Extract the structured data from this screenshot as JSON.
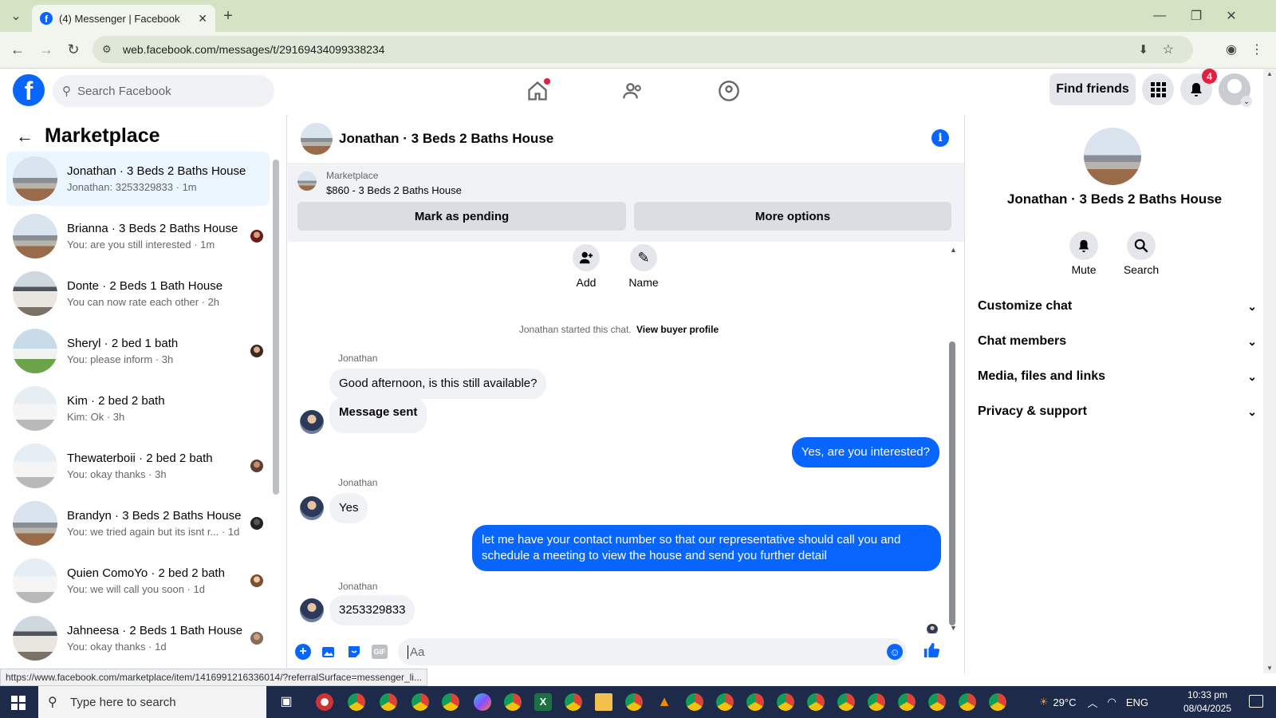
{
  "browser": {
    "tab_title": "(4) Messenger | Facebook",
    "url": "web.facebook.com/messages/t/29169434099338234",
    "status_url": "https://www.facebook.com/marketplace/item/1416991216336014/?referralSurface=messenger_li..."
  },
  "header": {
    "search_placeholder": "Search Facebook",
    "find_friends": "Find friends",
    "notification_count": "4"
  },
  "sidebar": {
    "title": "Marketplace",
    "conversations": [
      {
        "title": "Jonathan · 3 Beds 2 Baths House",
        "subtitle": "Jonathan: 3253329833 · 1m"
      },
      {
        "title": "Brianna · 3 Beds 2 Baths House",
        "subtitle": "You: are you still interested · 1m"
      },
      {
        "title": "Donte · 2 Beds 1 Bath House",
        "subtitle": "You can now rate each other · 2h"
      },
      {
        "title": "Sheryl · 2 bed 1 bath",
        "subtitle": "You: please inform · 3h"
      },
      {
        "title": "Kim · 2 bed 2 bath",
        "subtitle": "Kim: Ok · 3h"
      },
      {
        "title": "Thewaterboii · 2 bed 2 bath",
        "subtitle": "You: okay thanks · 3h"
      },
      {
        "title": "Brandyn · 3 Beds 2 Baths House",
        "subtitle": "You: we tried again but its isnt r...  · 1d"
      },
      {
        "title": "Quien ComoYo · 2 bed 2 bath",
        "subtitle": "You: we will call you soon · 1d"
      },
      {
        "title": "Jahneesa · 2 Beds 1 Bath House",
        "subtitle": "You: okay thanks · 1d"
      }
    ]
  },
  "chat": {
    "title": "Jonathan · 3 Beds 2 Baths House",
    "listing_label": "Marketplace",
    "listing_price": "$860 - 3 Beds 2 Baths House",
    "mark_pending": "Mark as pending",
    "more_options": "More options",
    "add_label": "Add",
    "name_label": "Name",
    "started_text": "Jonathan started this chat.",
    "view_buyer_profile": "View buyer profile",
    "sender": "Jonathan",
    "messages": [
      {
        "from": "them",
        "text": "Good afternoon, is this still available?"
      },
      {
        "from": "them",
        "text": "Message sent"
      },
      {
        "from": "me",
        "text": "Yes, are you interested?"
      },
      {
        "from": "them",
        "text": "Yes"
      },
      {
        "from": "me",
        "text": "let me have your contact number so that our representative should call you and schedule a meeting to view the house and send you further detail"
      },
      {
        "from": "them",
        "text": "3253329833"
      }
    ],
    "composer_placeholder": "Aa"
  },
  "info_panel": {
    "name": "Jonathan · 3 Beds 2 Baths House",
    "mute": "Mute",
    "search": "Search",
    "sections": [
      "Customize chat",
      "Chat members",
      "Media, files and links",
      "Privacy & support"
    ]
  },
  "taskbar": {
    "search_placeholder": "Type here to search",
    "temperature": "29°C",
    "language": "ENG",
    "time": "10:33 pm",
    "date": "08/04/2025"
  },
  "colors": {
    "accent": "#0866ff",
    "bubble_in": "#f0f2f5",
    "selected_row": "#ebf5ff",
    "notif_badge": "#e41e3f"
  }
}
